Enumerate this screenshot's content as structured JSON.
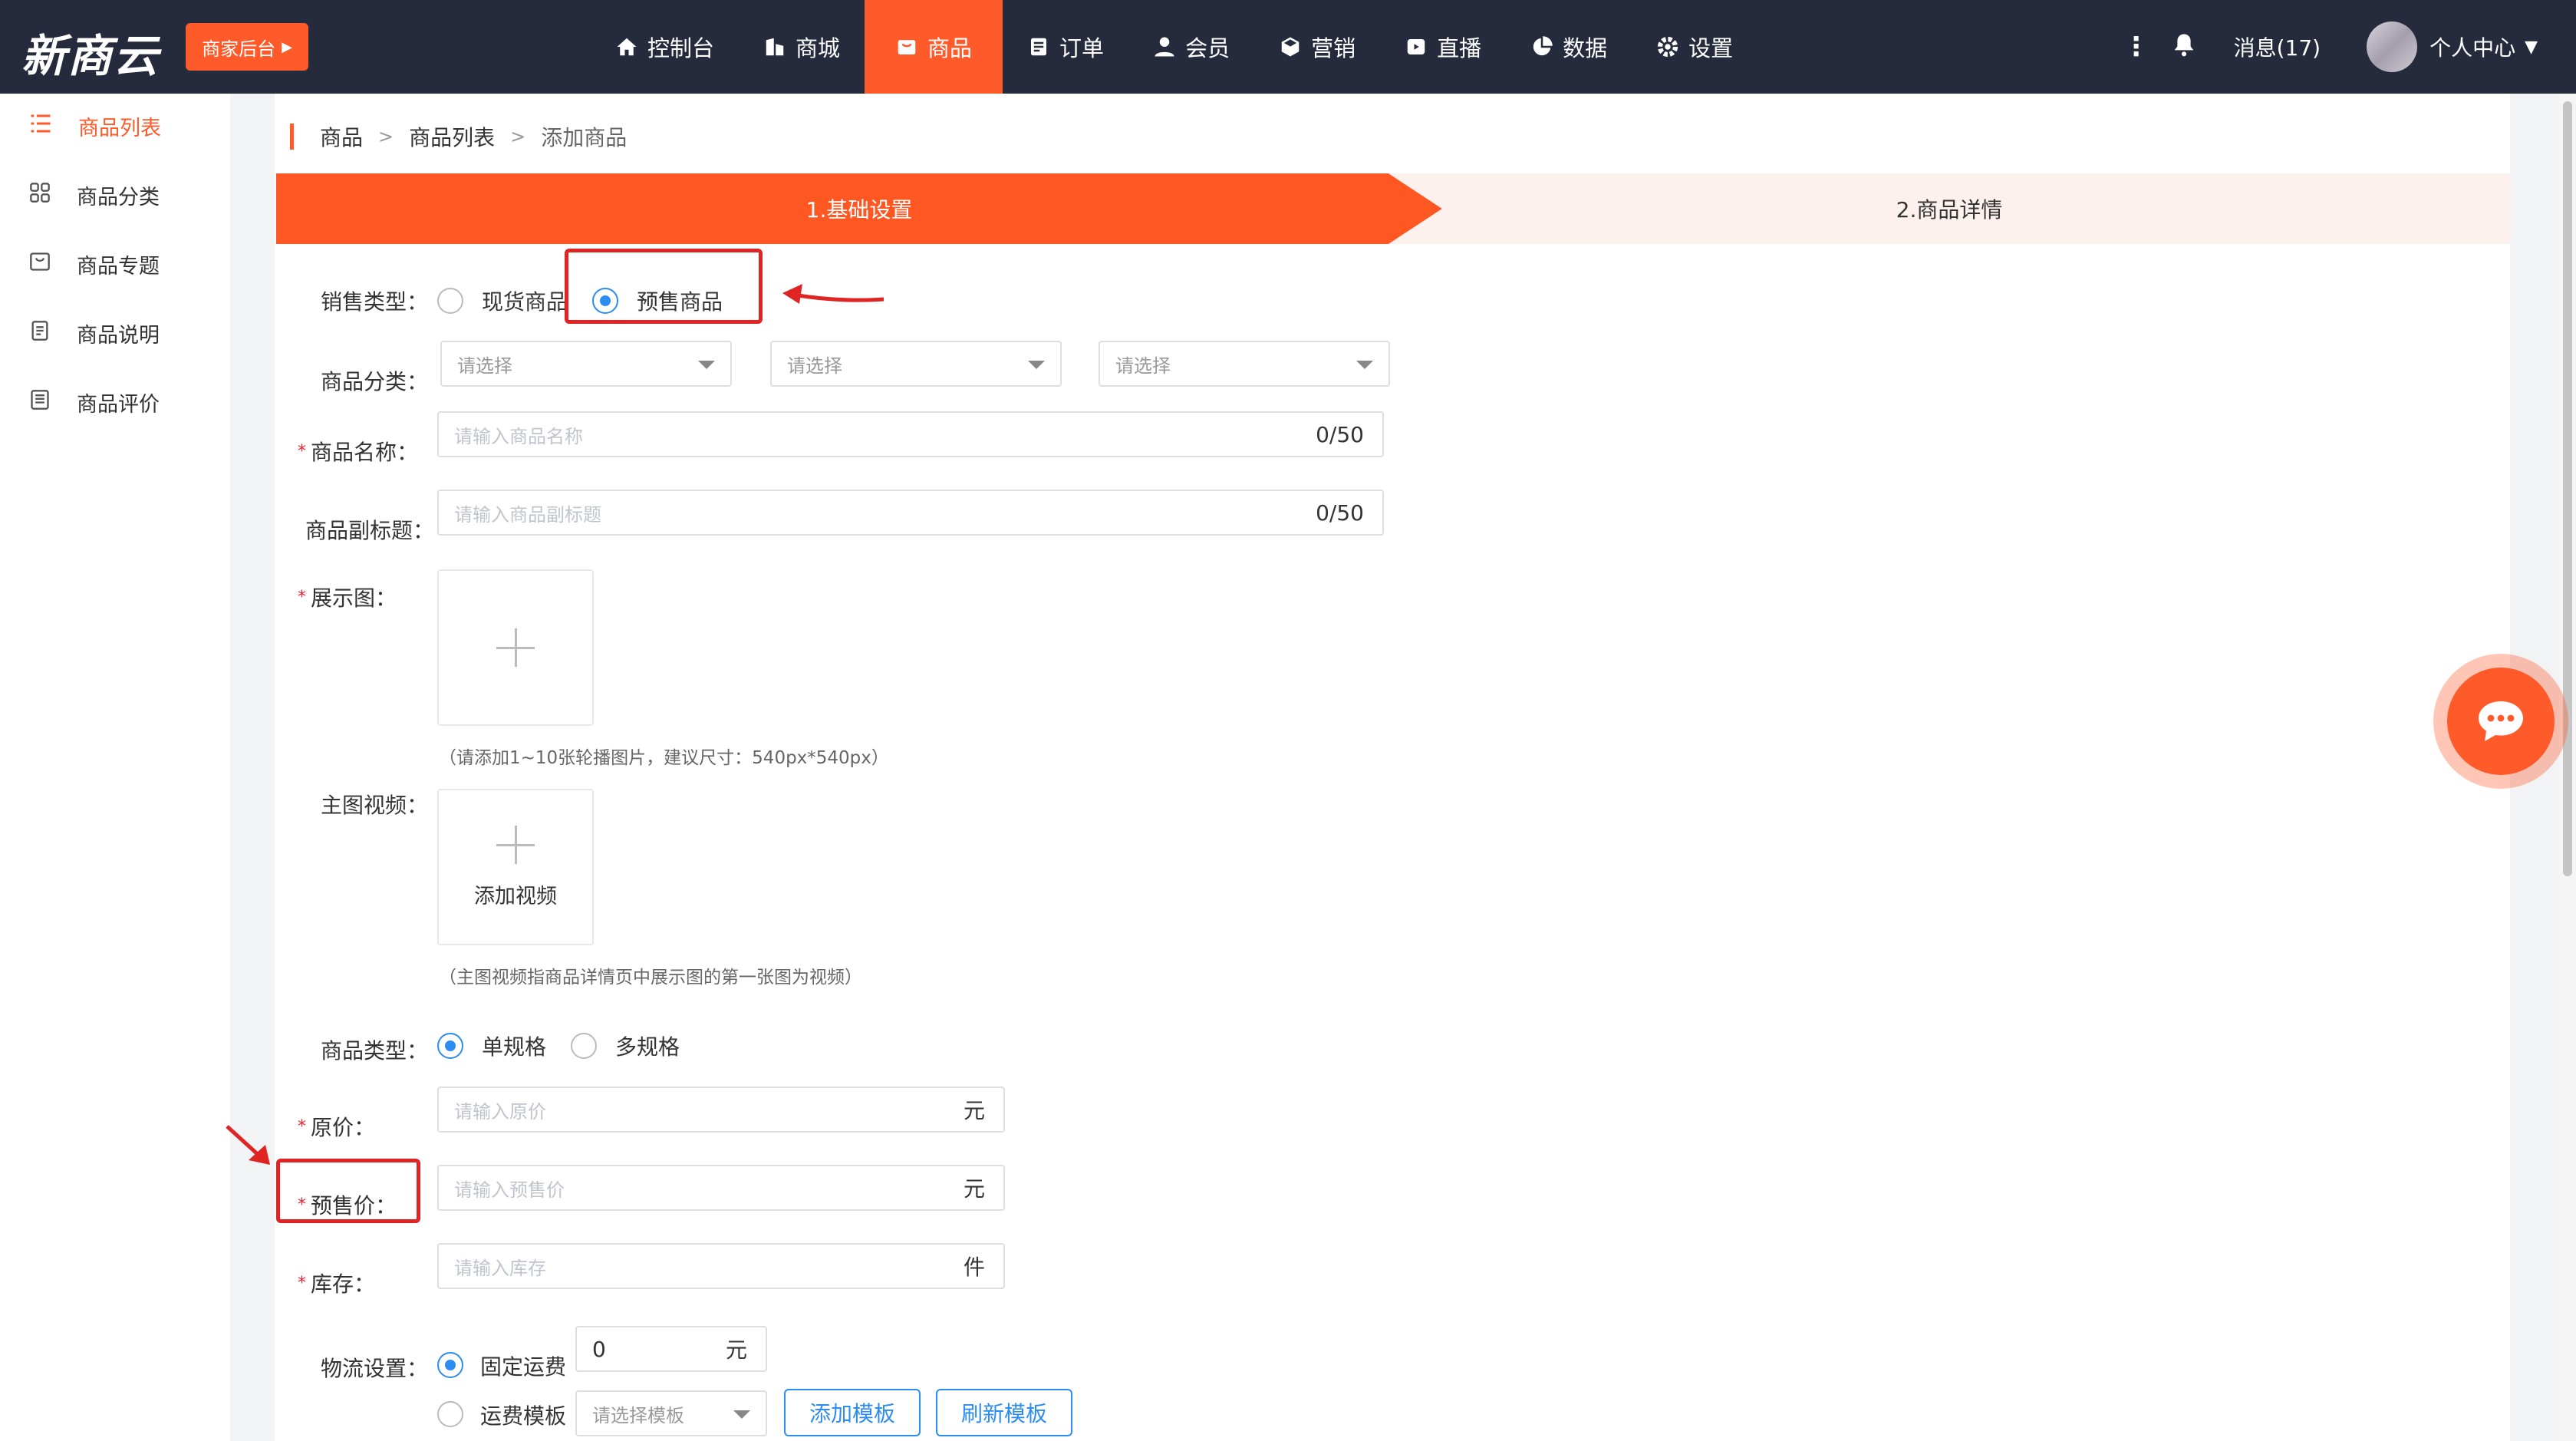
{
  "brand": {
    "logo": "新商云",
    "merchant_btn": "商家后台"
  },
  "nav": {
    "items": [
      {
        "label": "控制台",
        "icon": "home-icon"
      },
      {
        "label": "商城",
        "icon": "building-icon"
      },
      {
        "label": "商品",
        "icon": "bag-icon",
        "active": true
      },
      {
        "label": "订单",
        "icon": "list-icon"
      },
      {
        "label": "会员",
        "icon": "user-icon"
      },
      {
        "label": "营销",
        "icon": "box-icon"
      },
      {
        "label": "直播",
        "icon": "play-icon"
      },
      {
        "label": "数据",
        "icon": "pie-icon"
      },
      {
        "label": "设置",
        "icon": "gear-icon"
      }
    ],
    "messages": "消息(17)",
    "profile": "个人中心"
  },
  "sidebar": {
    "items": [
      {
        "label": "商品列表",
        "active": true
      },
      {
        "label": "商品分类"
      },
      {
        "label": "商品专题"
      },
      {
        "label": "商品说明"
      },
      {
        "label": "商品评价"
      }
    ]
  },
  "breadcrumb": {
    "level1": "商品",
    "sep": ">",
    "level2": "商品列表",
    "level3": "添加商品"
  },
  "steps": {
    "step1": "1.基础设置",
    "step2": "2.商品详情"
  },
  "form": {
    "sale_type": {
      "label": "销售类型：",
      "opt1": "现货商品",
      "opt2": "预售商品",
      "selected": "预售商品"
    },
    "category": {
      "label": "商品分类：",
      "placeholder": "请选择"
    },
    "name": {
      "label": "商品名称：",
      "placeholder": "请输入商品名称",
      "count": "0/50"
    },
    "subtitle": {
      "label": "商品副标题：",
      "placeholder": "请输入商品副标题",
      "count": "0/50"
    },
    "images": {
      "label": "展示图：",
      "hint": "（请添加1~10张轮播图片，建议尺寸：540px*540px）"
    },
    "video": {
      "label": "主图视频：",
      "btn": "添加视频",
      "hint": "（主图视频指商品详情页中展示图的第一张图为视频）"
    },
    "goods_type": {
      "label": "商品类型：",
      "opt1": "单规格",
      "opt2": "多规格",
      "selected": "单规格"
    },
    "price": {
      "label": "原价：",
      "placeholder": "请输入原价",
      "unit": "元"
    },
    "presale_price": {
      "label": "预售价：",
      "placeholder": "请输入预售价",
      "unit": "元"
    },
    "stock": {
      "label": "库存：",
      "placeholder": "请输入库存",
      "unit": "件"
    },
    "logistics": {
      "label": "物流设置：",
      "opt1": "固定运费",
      "fixed_value": "0",
      "fixed_unit": "元",
      "opt2": "运费模板",
      "template_placeholder": "请选择模板",
      "add_btn": "添加模板",
      "refresh_btn": "刷新模板",
      "selected": "固定运费"
    }
  },
  "colors": {
    "accent": "#ff5a2a",
    "nav_bg": "#252a3d",
    "link": "#2d8cf0",
    "highlight": "#e02424"
  }
}
